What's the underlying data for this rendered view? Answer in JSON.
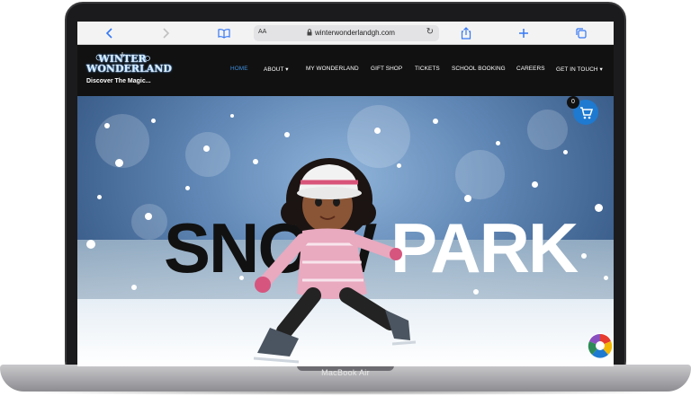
{
  "browser": {
    "url": "winterwonderlandgh.com",
    "text_size_label": "AA",
    "icons": [
      "back-icon",
      "forward-icon",
      "bookmarks-icon",
      "lock-icon",
      "reload-icon",
      "share-icon",
      "new-tab-icon",
      "tabs-icon"
    ]
  },
  "site": {
    "logo_text": "WINTER WONDERLAND",
    "tagline": "Discover The Magic...",
    "nav": [
      {
        "label": "HOME",
        "active": true
      },
      {
        "label": "ABOUT",
        "dropdown": true
      },
      {
        "label": "MY WONDERLAND"
      },
      {
        "label": "GIFT SHOP"
      },
      {
        "label": "TICKETS"
      },
      {
        "label": "SCHOOL BOOKING"
      },
      {
        "label": "CAREERS"
      },
      {
        "label": "GET IN TOUCH",
        "dropdown": true
      }
    ],
    "nav_dropdown_glyph": "▾",
    "accent_color": "#3d8fdd"
  },
  "hero": {
    "word_left": "SNOW",
    "word_right": "PARK"
  },
  "cart": {
    "count": "0"
  },
  "device": {
    "label": "MacBook Air"
  }
}
